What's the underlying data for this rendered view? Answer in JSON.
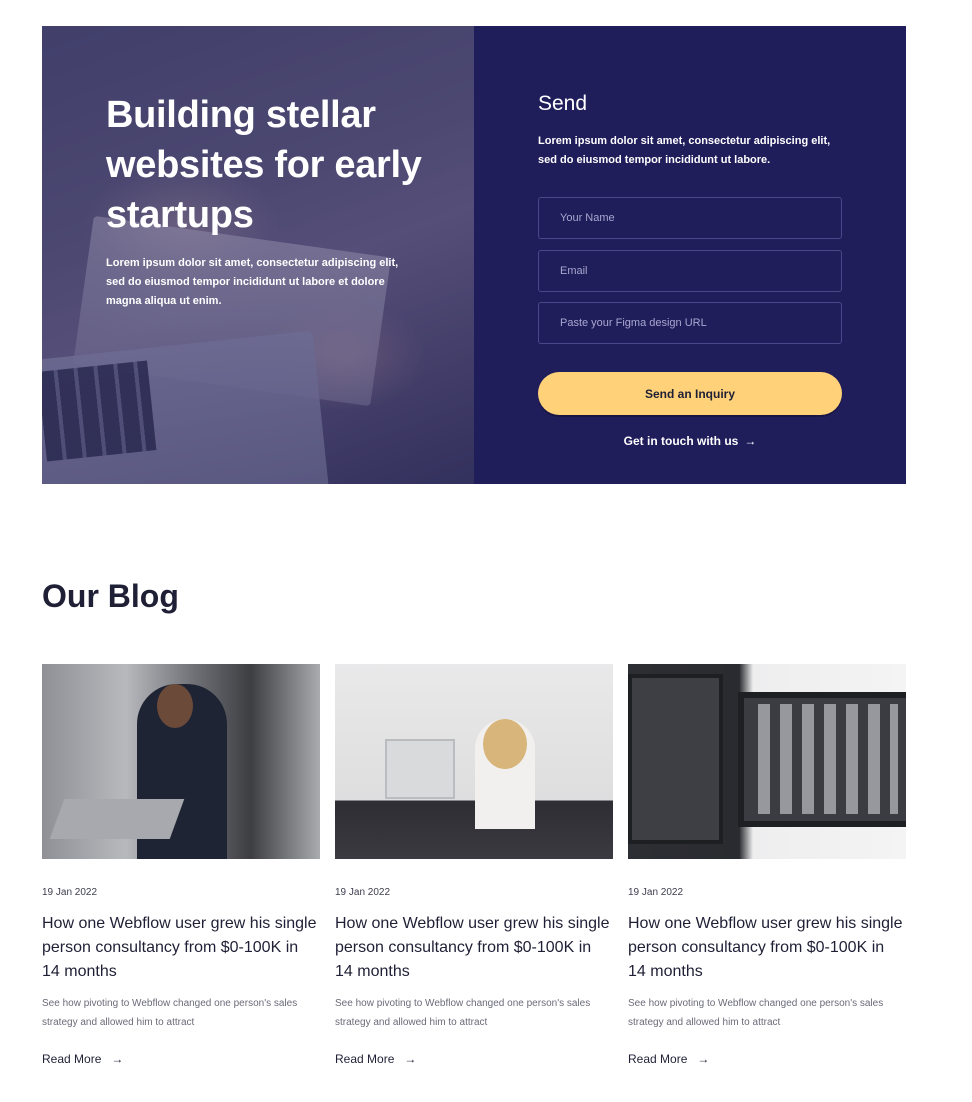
{
  "hero": {
    "title": "Building stellar websites for early startups",
    "description": "Lorem ipsum dolor sit amet, consectetur adipiscing elit, sed do eiusmod tempor incididunt ut labore et dolore magna aliqua ut enim."
  },
  "form": {
    "title": "Send",
    "description": "Lorem ipsum dolor sit amet, consectetur adipiscing elit, sed do eiusmod tempor incididunt ut labore.",
    "name_placeholder": "Your Name",
    "email_placeholder": "Email",
    "url_placeholder": "Paste your Figma design URL",
    "submit_label": "Send an Inquiry",
    "contact_link": "Get in touch with us",
    "arrow": "→"
  },
  "blog": {
    "title": "Our Blog",
    "posts": [
      {
        "date": "19 Jan 2022",
        "title": "How one Webflow user grew his single person consultancy from $0-100K in 14 months",
        "excerpt": "See how pivoting to Webflow changed one person's sales strategy and allowed him to attract",
        "read_more": "Read More",
        "arrow": "→"
      },
      {
        "date": "19 Jan 2022",
        "title": "How one Webflow user grew his single person consultancy from $0-100K in 14 months",
        "excerpt": "See how pivoting to Webflow changed one person's sales strategy and allowed him to attract",
        "read_more": "Read More",
        "arrow": "→"
      },
      {
        "date": "19 Jan 2022",
        "title": "How one Webflow user grew his single person consultancy from $0-100K in 14 months",
        "excerpt": "See how pivoting to Webflow changed one person's sales strategy and allowed him to attract",
        "read_more": "Read More",
        "arrow": "→"
      }
    ]
  },
  "colors": {
    "form_bg": "#201d5b",
    "accent_button": "#ffd27a",
    "text_dark": "#1f1f36"
  }
}
